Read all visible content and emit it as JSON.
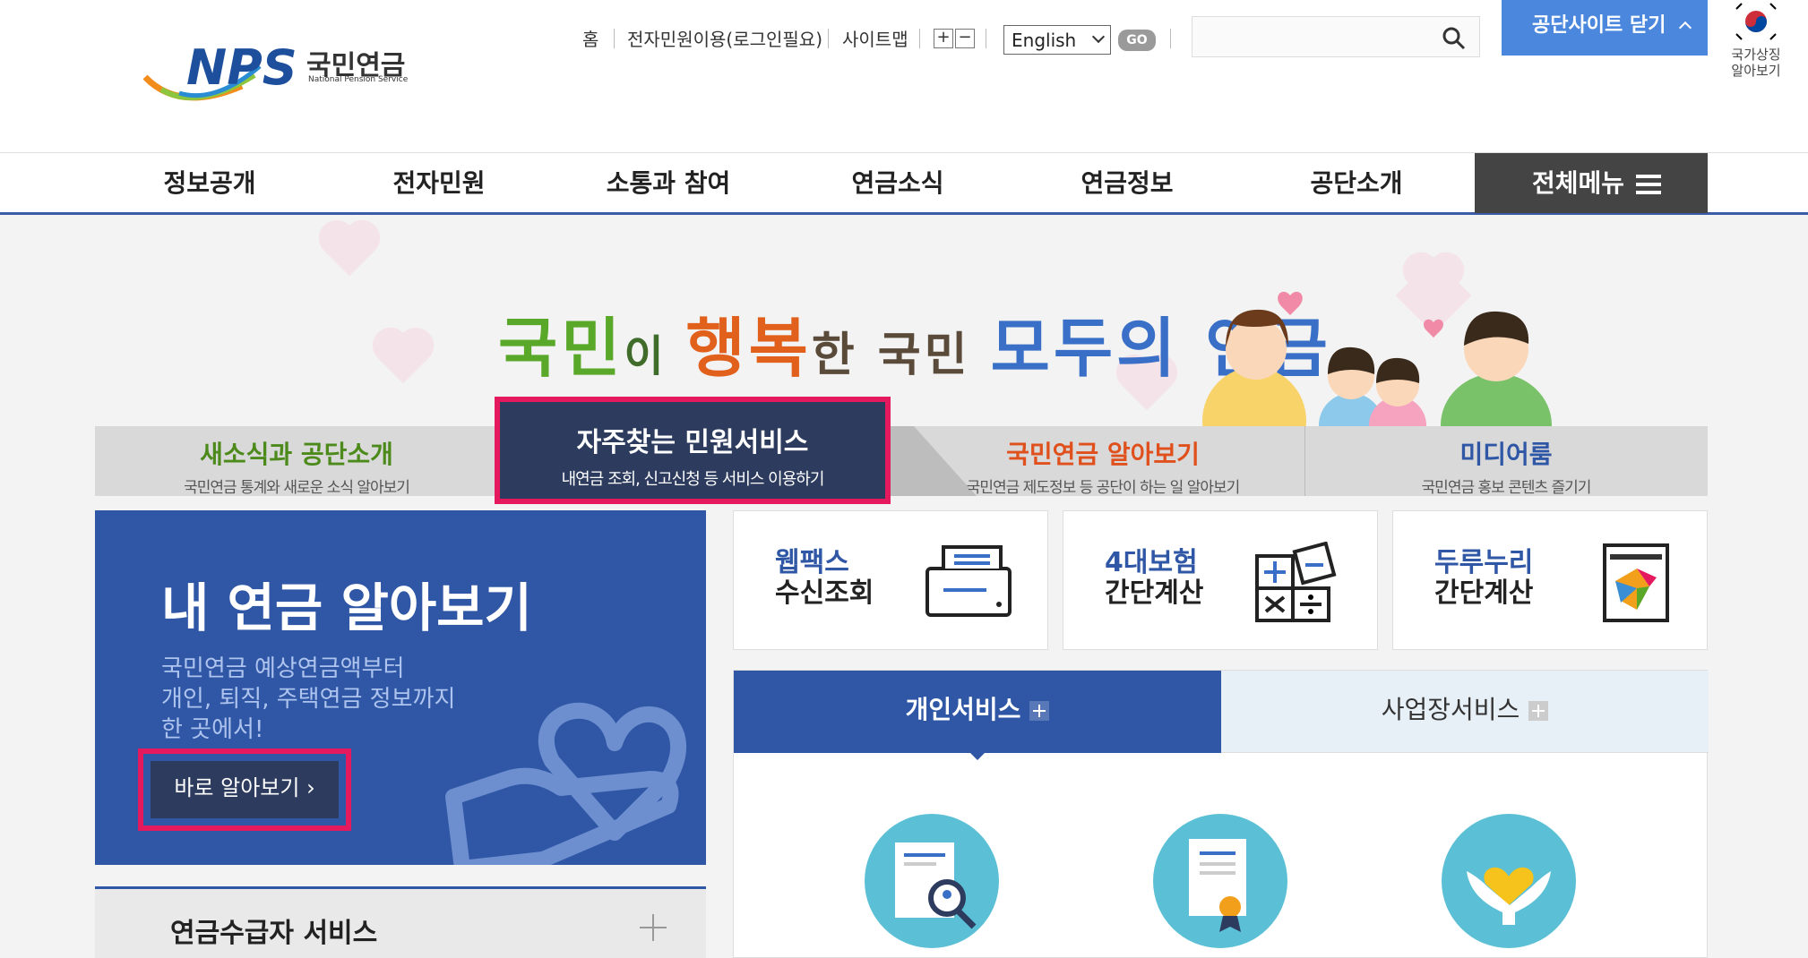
{
  "header": {
    "logo_text": "NPS",
    "logo_korean": "국민연금",
    "logo_english": "National Pension Service",
    "util_links": [
      "홈",
      "전자민원이용(로그인필요)",
      "사이트맵"
    ],
    "zoom_in": "+",
    "zoom_out": "−",
    "language": "English",
    "go_label": "GO",
    "search_placeholder": "",
    "close_site_label": "공단사이트 닫기",
    "national_symbol_line1": "국가상징",
    "national_symbol_line2": "알아보기"
  },
  "nav": {
    "items": [
      "정보공개",
      "전자민원",
      "소통과 참여",
      "연금소식",
      "연금정보",
      "공단소개"
    ],
    "all_menu_label": "전체메뉴"
  },
  "banner": {
    "slogan_parts": [
      "국민",
      "이 ",
      "행복",
      "한 국민 ",
      "모두의",
      " 연금"
    ]
  },
  "tabs": [
    {
      "title": "새소식과 공단소개",
      "sub": "국민연금 통계와 새로운 소식 알아보기",
      "color": "#4b8a1b"
    },
    {
      "title": "자주찾는 민원서비스",
      "sub": "내연금 조회, 신고신청 등 서비스 이용하기",
      "color": "#ffffff"
    },
    {
      "title": "국민연금 알아보기",
      "sub": "국민연금 제도정보 등 공단이 하는 일 알아보기",
      "color": "#e0501c"
    },
    {
      "title": "미디어룸",
      "sub": "국민연금 홍보 콘텐츠 즐기기",
      "color": "#2f57a6"
    }
  ],
  "my_pension": {
    "title": "내 연금 알아보기",
    "desc": [
      "국민연금 예상연금액부터",
      "개인, 퇴직, 주택연금 정보까지",
      "한 곳에서!"
    ],
    "button": "바로 알아보기 ›"
  },
  "pensioner_service": "연금수급자 서비스",
  "quick_cards": [
    {
      "line1": "웹팩스",
      "line2": "수신조회",
      "icon": "fax-icon"
    },
    {
      "line1": "4대보험",
      "line2": "간단계산",
      "icon": "calculator-icon"
    },
    {
      "line1": "두루누리",
      "line2": "간단계산",
      "icon": "durunuri-icon"
    }
  ],
  "service_tabs": {
    "personal": "개인서비스",
    "business": "사업장서비스"
  },
  "colors": {
    "primary": "#2f57a6",
    "dark": "#2d3b5e",
    "highlight": "#e5195e",
    "close_button": "#4a87dd"
  }
}
